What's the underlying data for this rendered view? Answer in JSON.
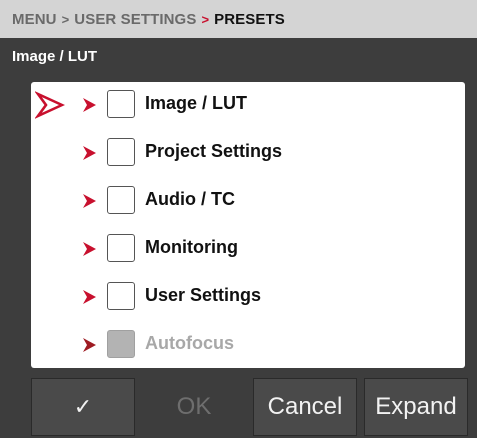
{
  "breadcrumb": {
    "menu": "MENU",
    "sep1": ">",
    "user_settings": "USER SETTINGS",
    "sep2": ">",
    "presets": "PRESETS"
  },
  "section_title": "Image / LUT",
  "list": {
    "items": [
      {
        "label": "Image / LUT",
        "enabled": true,
        "focused": true,
        "checked": false
      },
      {
        "label": "Project Settings",
        "enabled": true,
        "focused": false,
        "checked": false
      },
      {
        "label": "Audio / TC",
        "enabled": true,
        "focused": false,
        "checked": false
      },
      {
        "label": "Monitoring",
        "enabled": true,
        "focused": false,
        "checked": false
      },
      {
        "label": "User Settings",
        "enabled": true,
        "focused": false,
        "checked": false
      },
      {
        "label": "Autofocus",
        "enabled": false,
        "focused": false,
        "checked": false
      }
    ]
  },
  "icons": {
    "focus": "focus-arrow-icon",
    "expand": "chevron-right-icon",
    "confirm": "checkmark-icon"
  },
  "toolbar": {
    "check_label": "✓",
    "ok_label": "OK",
    "cancel_label": "Cancel",
    "expand_label": "Expand"
  },
  "colors": {
    "accent_red": "#c8102e",
    "breadcrumb_bg": "#d4d4d4",
    "panel_bg": "#3d3d3d"
  }
}
